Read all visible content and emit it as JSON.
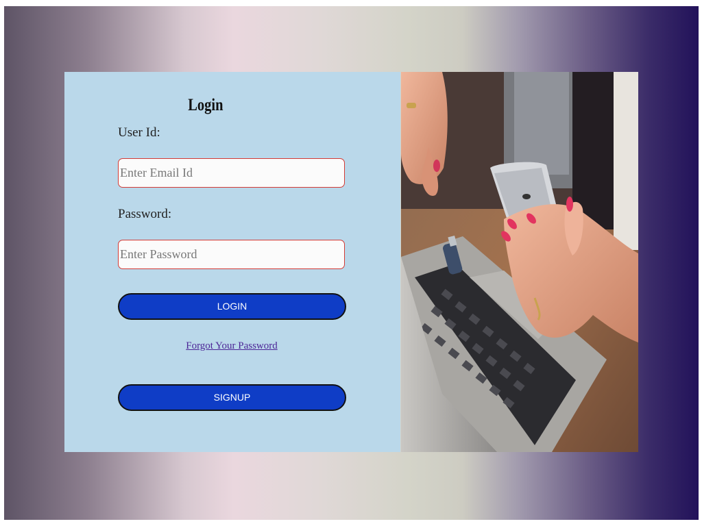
{
  "login": {
    "title": "Login",
    "user_label": "User Id:",
    "email_placeholder": "Enter Email Id",
    "password_label": "Password:",
    "password_placeholder": "Enter Password",
    "login_button": "LOGIN",
    "forgot_link": "Forgot Your Password",
    "signup_button": "SIGNUP"
  },
  "colors": {
    "card_background": "#bad8ea",
    "button_background": "#0f3dc6",
    "input_border": "#d33a35",
    "link_color": "#4b2596"
  }
}
